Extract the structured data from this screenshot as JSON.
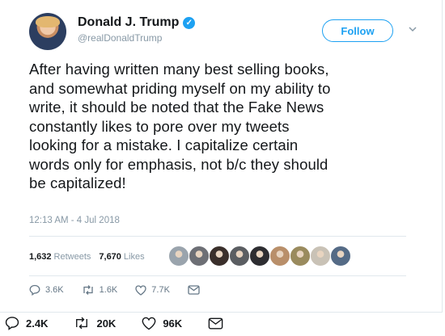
{
  "user": {
    "name": "Donald J. Trump",
    "handle": "@realDonaldTrump",
    "follow_label": "Follow"
  },
  "tweet": {
    "lines": [
      "After having written many best selling books,",
      "and somewhat priding myself on my ability to",
      "write, it should be noted that the Fake News",
      "constantly likes to pore over my tweets",
      "looking for a mistake. I capitalize certain",
      "words only for emphasis, not b/c they should",
      "be capitalized!"
    ],
    "timestamp": "12:13 AM - 4 Jul 2018"
  },
  "stats": {
    "retweets_count": "1,632",
    "retweets_label": "Retweets",
    "likes_count": "7,670",
    "likes_label": "Likes"
  },
  "liker_avatar_colors": [
    "#9aa4ad",
    "#6d6f75",
    "#3a2f2b",
    "#5b5e62",
    "#2d2d31",
    "#b98f6a",
    "#9a8b5e",
    "#c9c2b6",
    "#556b86"
  ],
  "actions": {
    "reply": "3.6K",
    "retweet": "1.6K",
    "like": "7.7K"
  },
  "outer_actions": {
    "reply": "2.4K",
    "retweet": "20K",
    "like": "96K"
  },
  "colors": {
    "accent": "#1da1f2",
    "text": "#14171a",
    "muted": "#8899a6"
  }
}
